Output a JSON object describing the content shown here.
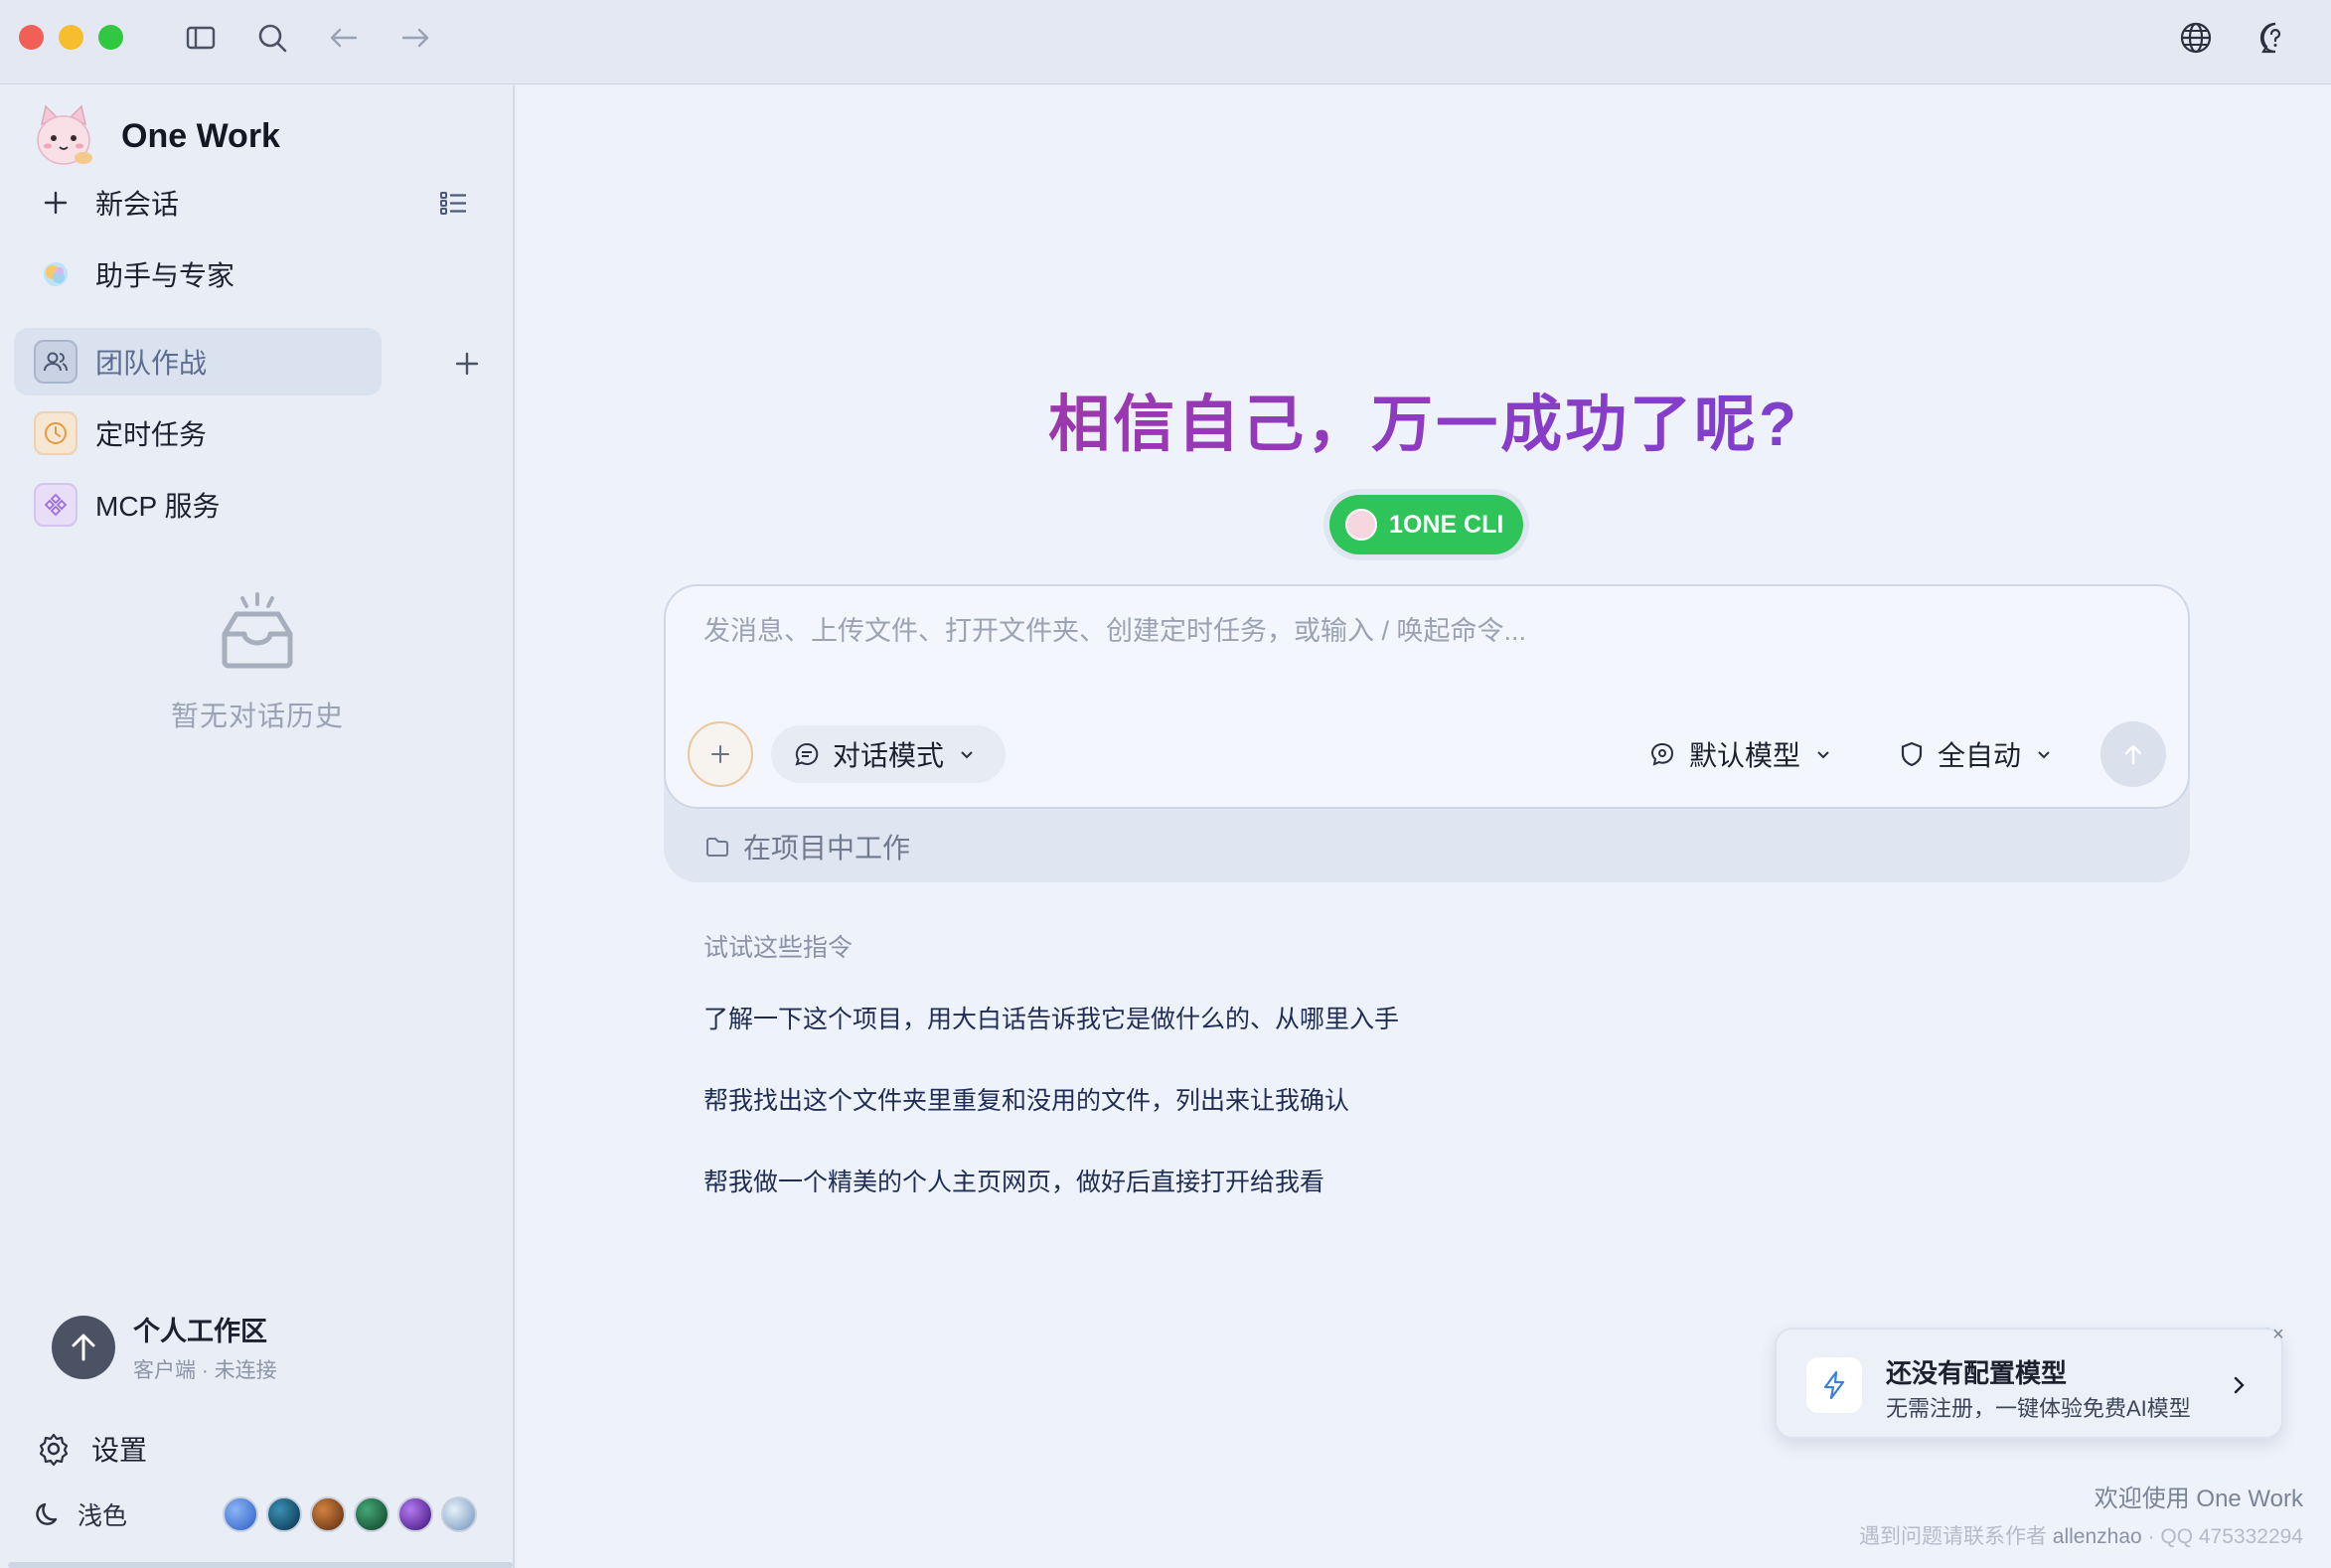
{
  "app": {
    "name": "One Work"
  },
  "sidebar": {
    "new_chat": "新会话",
    "items": [
      {
        "label": "助手与专家",
        "icon": "assistant-icon"
      },
      {
        "label": "团队作战",
        "icon": "team-icon"
      },
      {
        "label": "定时任务",
        "icon": "clock-icon"
      },
      {
        "label": "MCP 服务",
        "icon": "mcp-icon"
      }
    ],
    "empty_history": "暂无对话历史",
    "workspace": {
      "title": "个人工作区",
      "status": "客户端 · 未连接"
    },
    "settings": "设置",
    "theme": {
      "label": "浅色",
      "swatches": [
        "#4a7fe0",
        "#0f4c6e",
        "#8a4a1c",
        "#1f6b45",
        "#6b2fb3",
        "#aac2dc"
      ]
    }
  },
  "main": {
    "headline": "相信自己，万一成功了呢?",
    "cli_badge": "1ONE CLI",
    "composer": {
      "placeholder": "发消息、上传文件、打开文件夹、创建定时任务，或输入 / 唤起命令...",
      "mode": "对话模式",
      "model": "默认模型",
      "autonomy": "全自动",
      "project": "在项目中工作"
    },
    "suggestions_title": "试试这些指令",
    "suggestions": [
      "了解一下这个项目，用大白话告诉我它是做什么的、从哪里入手",
      "帮我找出这个文件夹里重复和没用的文件，列出来让我确认",
      "帮我做一个精美的个人主页网页，做好后直接打开给我看"
    ]
  },
  "toast": {
    "title": "还没有配置模型",
    "subtitle": "无需注册，一键体验免费AI模型"
  },
  "footer": {
    "welcome": "欢迎使用 One Work",
    "contact_prefix": "遇到问题请联系作者",
    "author": "allenzhao",
    "qq": "QQ 475332294"
  },
  "colors": {
    "accent_green": "#2ec459",
    "headline_start": "#b1328d",
    "headline_end": "#6a46d6"
  }
}
